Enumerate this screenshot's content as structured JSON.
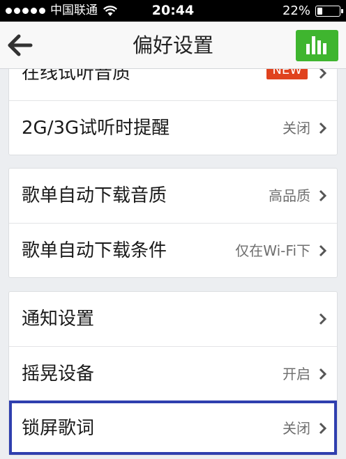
{
  "status_bar": {
    "carrier": "中国联通",
    "time": "20:44",
    "battery_text": "22%",
    "battery_level": 0.22
  },
  "nav": {
    "title": "偏好设置",
    "back_icon": "back-arrow-icon",
    "chart_icon": "bar-chart-icon",
    "chart_button_color": "#3fb52f"
  },
  "groups": [
    {
      "items": [
        {
          "label": "在线试听音质",
          "badge": "NEW"
        },
        {
          "label": "2G/3G试听时提醒",
          "value": "关闭"
        }
      ]
    },
    {
      "items": [
        {
          "label": "歌单自动下载音质",
          "value": "高品质"
        },
        {
          "label": "歌单自动下载条件",
          "value": "仅在Wi-Fi下"
        }
      ]
    },
    {
      "items": [
        {
          "label": "通知设置",
          "value": ""
        },
        {
          "label": "摇晃设备",
          "value": "开启"
        },
        {
          "label": "锁屏歌词",
          "value": "关闭",
          "highlighted": true
        }
      ]
    }
  ],
  "colors": {
    "background": "#eceef1",
    "badge": "#e0421e",
    "highlight_border": "#2f3fae"
  }
}
